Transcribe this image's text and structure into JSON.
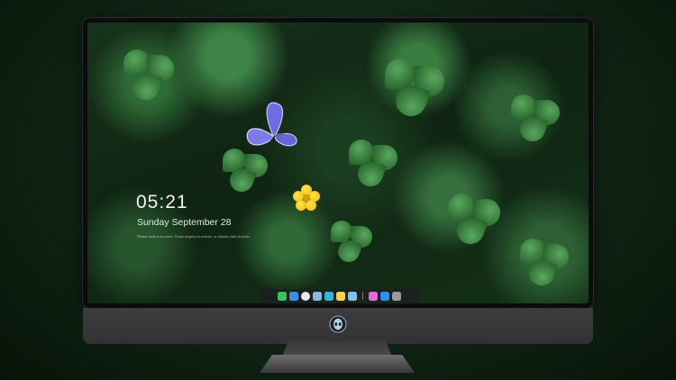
{
  "lockscreen": {
    "time": "05:21",
    "date": "Sunday September  28",
    "hint": "Please wait a moment. Press anykey to unlock, or double click to enter"
  },
  "dock": {
    "icons": [
      {
        "name": "messages-icon",
        "color": "#36c35a"
      },
      {
        "name": "finder-icon",
        "color": "#3a8ee8"
      },
      {
        "name": "safari-icon",
        "color": "#e9e9e9"
      },
      {
        "name": "files-icon",
        "color": "#8fb7d8"
      },
      {
        "name": "video-icon",
        "color": "#2fb6d9"
      },
      {
        "name": "notes-icon",
        "color": "#f5d34a"
      },
      {
        "name": "preview-icon",
        "color": "#7ac3ee"
      },
      {
        "name": "itunes-icon",
        "color": "#e56bd6"
      },
      {
        "name": "appstore-icon",
        "color": "#2f8df4"
      },
      {
        "name": "camera-icon",
        "color": "#9a9aa0"
      }
    ]
  },
  "device": {
    "logo": "alien-logo"
  }
}
